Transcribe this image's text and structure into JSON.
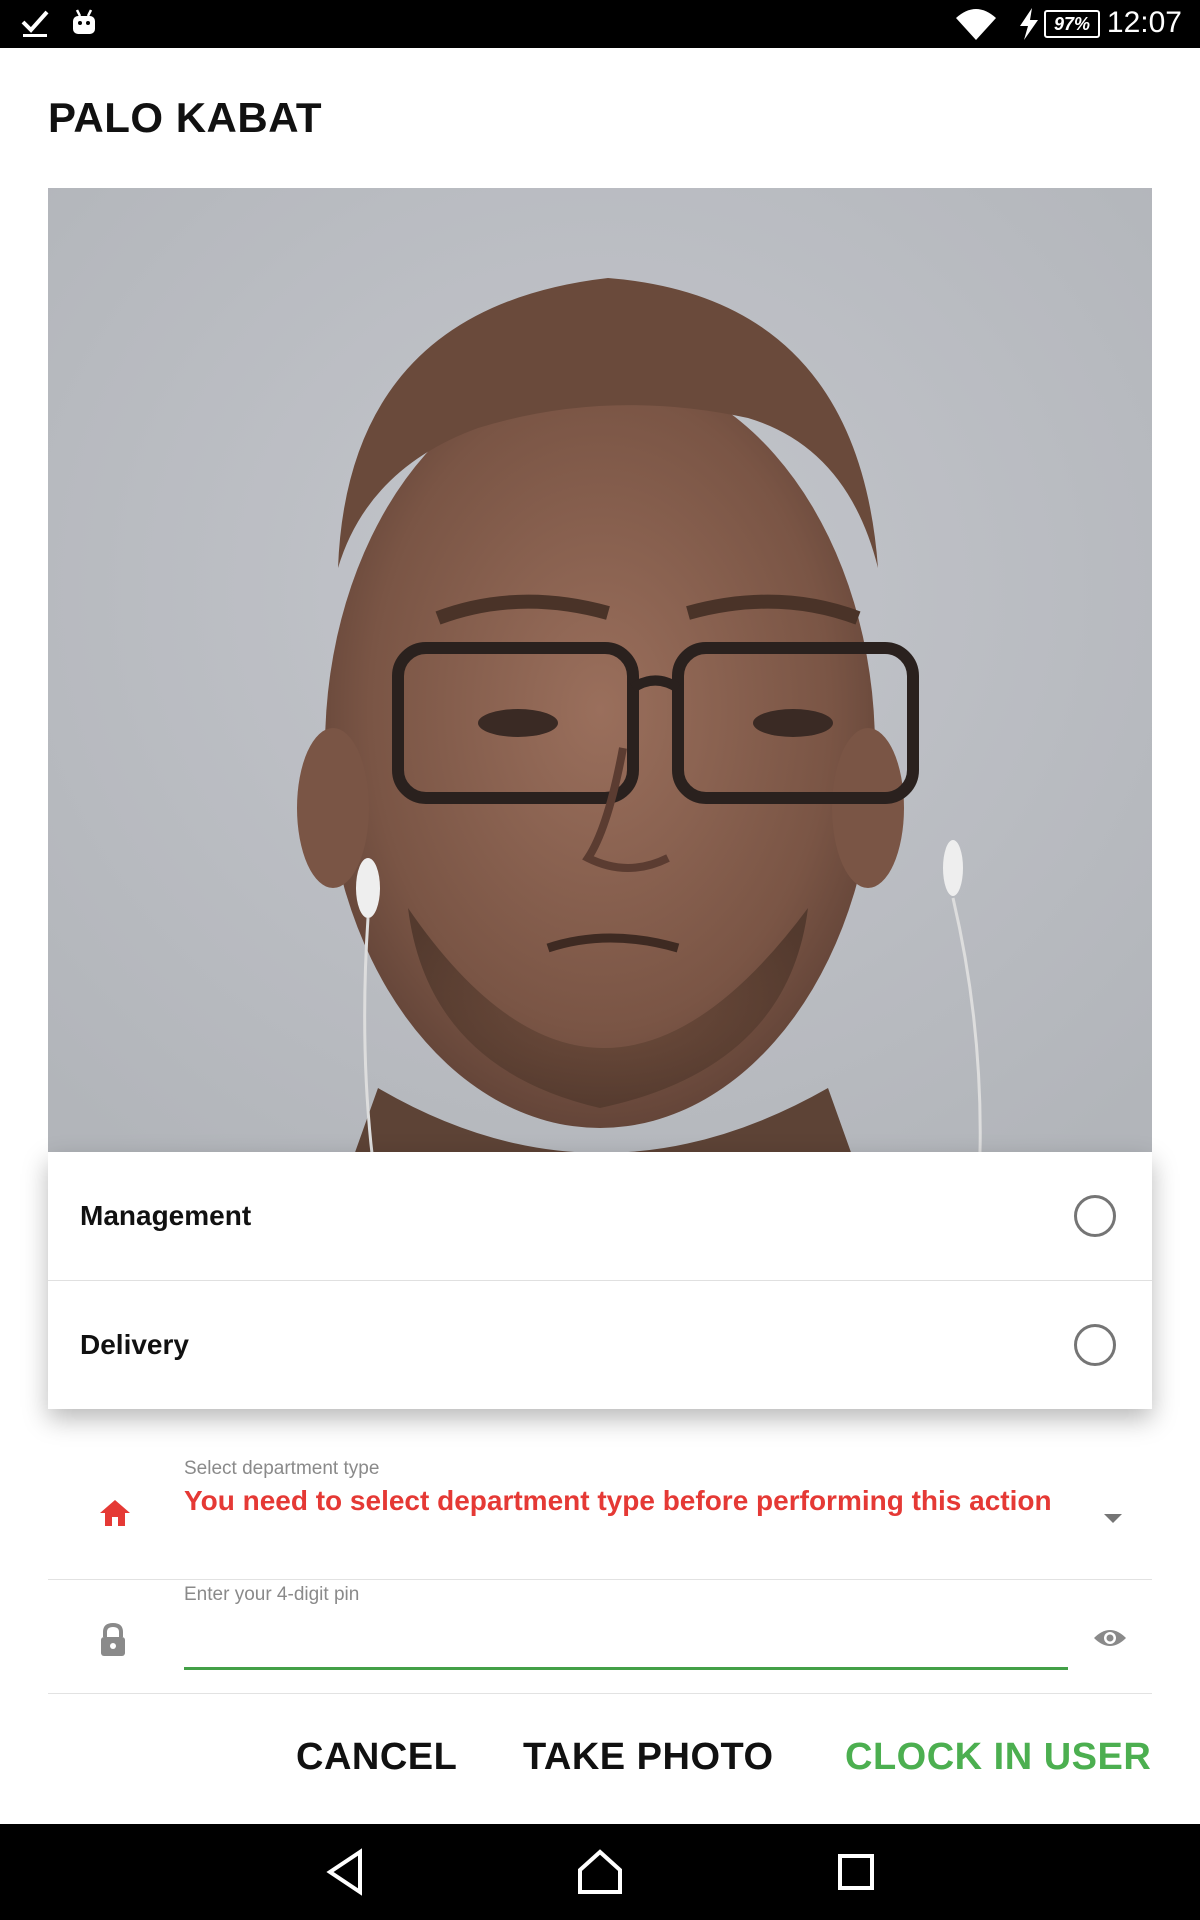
{
  "status_bar": {
    "time": "12:07",
    "battery": "97%",
    "icons": [
      "checkmark-download-icon",
      "android-icon",
      "wifi-icon",
      "charging-bolt-icon",
      "battery-icon"
    ]
  },
  "dialog": {
    "title": "PALO KABAT",
    "department_options": [
      {
        "label": "Management",
        "selected": false
      },
      {
        "label": "Delivery",
        "selected": false
      }
    ],
    "department_field": {
      "label": "Select department type",
      "error": "You need to select department type before performing this action",
      "icon": "home-icon"
    },
    "pin_field": {
      "label": "Enter your 4-digit pin",
      "value": "",
      "icon": "lock-icon",
      "toggle_icon": "eye-icon"
    },
    "actions": {
      "cancel": "CANCEL",
      "take_photo": "TAKE PHOTO",
      "clock_in": "CLOCK IN USER"
    }
  },
  "colors": {
    "error": "#e53935",
    "accent_green": "#4caf50",
    "underline_green": "#43a047"
  },
  "nav_bar": {
    "icons": [
      "back-icon",
      "home-nav-icon",
      "recents-icon"
    ]
  }
}
